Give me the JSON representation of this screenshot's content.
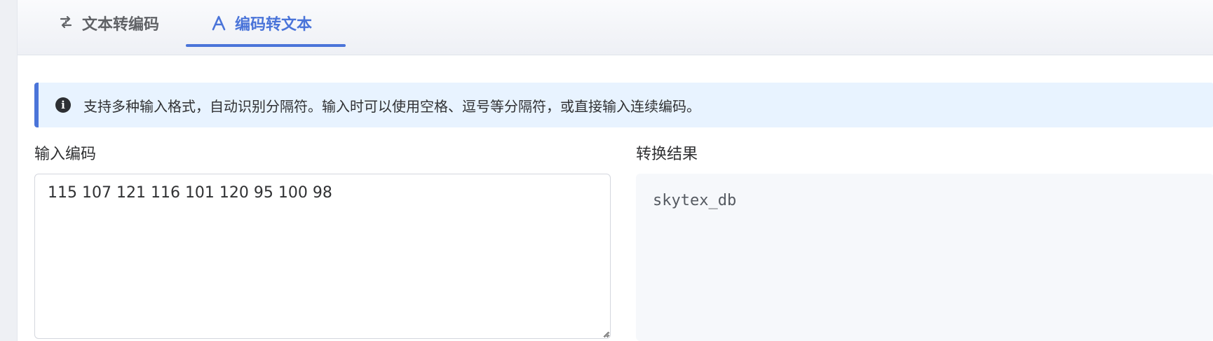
{
  "tabs": {
    "text_to_code": {
      "label": "文本转编码",
      "icon": "swap-icon"
    },
    "code_to_text": {
      "label": "编码转文本",
      "icon": "letter-a-icon",
      "active": true
    }
  },
  "alert": {
    "icon": "info-icon",
    "icon_glyph": "i",
    "message": "支持多种输入格式，自动识别分隔符。输入时可以使用空格、逗号等分隔符，或直接输入连续编码。"
  },
  "input": {
    "label": "输入编码",
    "value": "115 107 121 116 101 120 95 100 98"
  },
  "result": {
    "label": "转换结果",
    "value": "skytex_db"
  },
  "colors": {
    "accent": "#4a74d9",
    "alert_bg": "#e8f3ff",
    "result_bg": "#f6f8fb"
  }
}
